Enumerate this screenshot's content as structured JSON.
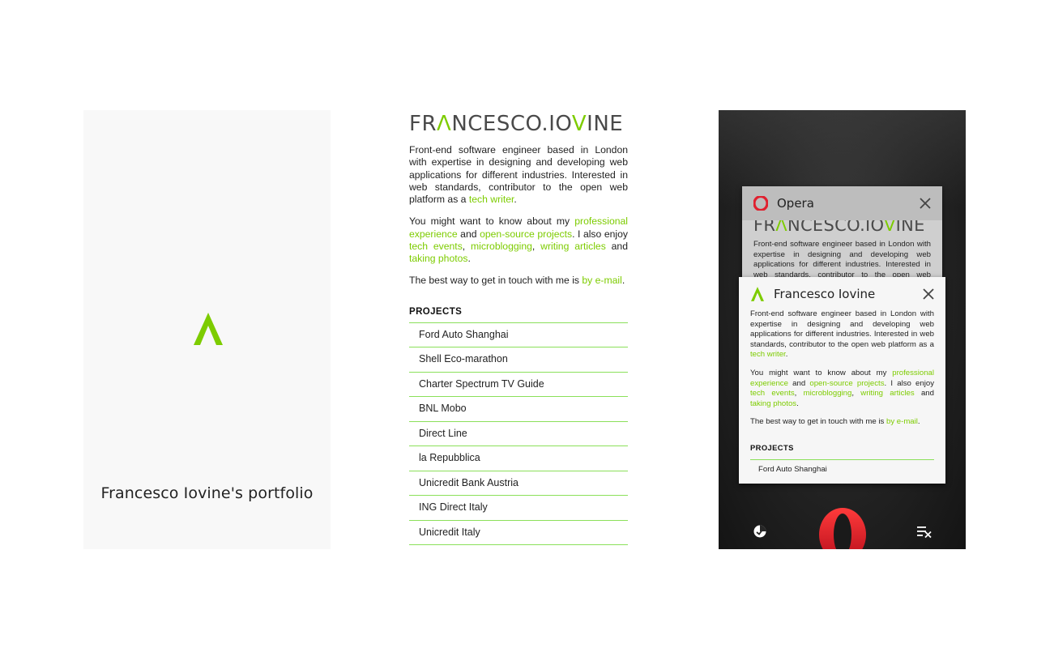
{
  "splash": {
    "title": "Francesco Iovine's portfolio"
  },
  "site": {
    "brand_before": "FR",
    "brand_accent": "Λ",
    "brand_middle": "NCESCO.IO",
    "brand_accent2": "V",
    "brand_after": "INE",
    "bio": {
      "p1_text": "Front-end software engineer based in London with expertise in designing and developing web applications for different industries. Interested in web standards, contributor to the open web platform as a ",
      "p1_link": "tech writer",
      "p1_end": ".",
      "p2_text": "You might want to know about my ",
      "p2_link1": "professional experience",
      "p2_and": " and ",
      "p2_link2": "open-source projects",
      "p2_mid": ". I also enjoy ",
      "p2_link3": "tech events",
      "p2_sep1": ", ",
      "p2_link4": "microblogging",
      "p2_sep2": ", ",
      "p2_link5": "writing articles",
      "p2_and2": " and ",
      "p2_link6": "taking photos",
      "p2_end": ".",
      "p3_text": "The best way to get in touch with me is ",
      "p3_link": "by e-mail",
      "p3_end": "."
    },
    "projects_title": "PROJECTS",
    "projects": [
      "Ford Auto Shanghai",
      "Shell Eco-marathon",
      "Charter Spectrum TV Guide",
      "BNL Mobo",
      "Direct Line",
      "la Repubblica",
      "Unicredit Bank Austria",
      "ING Direct Italy",
      "Unicredit Italy"
    ]
  },
  "tab_switcher": {
    "back_tab_title": "Opera",
    "front_tab_title": "Francesco Iovine",
    "front_tab_first_project": "Ford Auto Shanghai"
  },
  "colors": {
    "accent": "#7dcc00",
    "rule": "#8be05a",
    "opera_red": "#e0202f"
  },
  "icons": {
    "splash_logo": "lambda-logo-icon",
    "opera": "opera-icon",
    "close": "close-icon",
    "tabs": "tabs-icon",
    "clear_tabs": "clear-tabs-icon"
  }
}
